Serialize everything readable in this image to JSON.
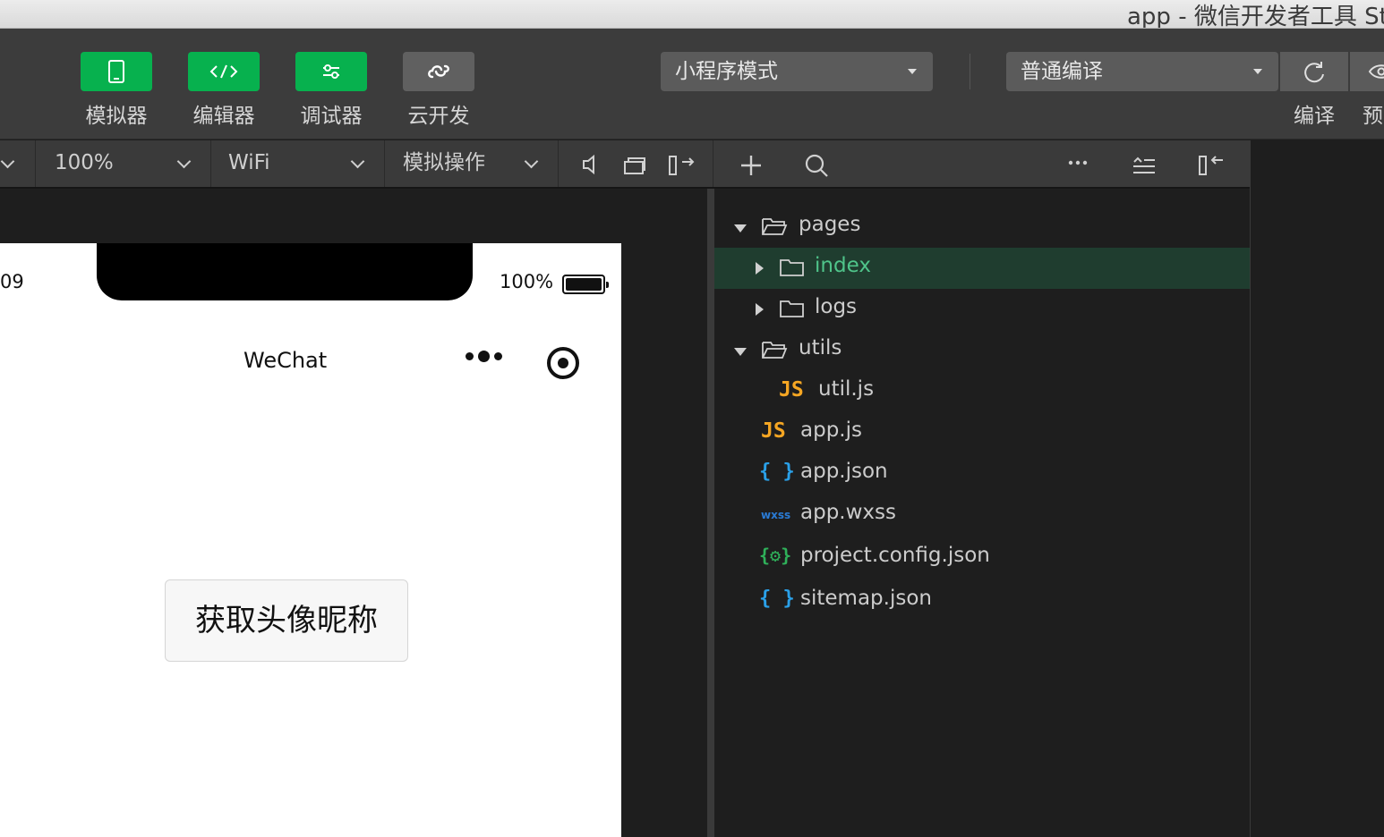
{
  "window": {
    "title": "app - 微信开发者工具 St"
  },
  "toolbar": {
    "buttons": [
      {
        "label": "模拟器",
        "icon": "phone-icon"
      },
      {
        "label": "编辑器",
        "icon": "code-icon"
      },
      {
        "label": "调试器",
        "icon": "sliders-icon"
      },
      {
        "label": "云开发",
        "icon": "cloud-icon"
      }
    ],
    "mode_select": "小程序模式",
    "compile_select": "普通编译",
    "compile_label": "编译",
    "preview_label": "预"
  },
  "subbar": {
    "zoom": "100%",
    "network": "WiFi",
    "simulate_ops": "模拟操作"
  },
  "simulator": {
    "status_time": "09",
    "battery_percent": "100%",
    "nav_title": "WeChat",
    "avatar_button": "获取头像昵称"
  },
  "explorer": {
    "items": [
      {
        "label": "pages",
        "type": "folder",
        "expanded": true
      },
      {
        "label": "index",
        "type": "folder",
        "expanded": false,
        "selected": true
      },
      {
        "label": "logs",
        "type": "folder",
        "expanded": false
      },
      {
        "label": "utils",
        "type": "folder",
        "expanded": true
      },
      {
        "label": "util.js",
        "type": "js",
        "icon_text": "JS"
      },
      {
        "label": "app.js",
        "type": "js",
        "icon_text": "JS"
      },
      {
        "label": "app.json",
        "type": "json",
        "icon_text": "{ }"
      },
      {
        "label": "app.wxss",
        "type": "wxss",
        "icon_text": "wxss"
      },
      {
        "label": "project.config.json",
        "type": "config",
        "icon_text": "{⚙}"
      },
      {
        "label": "sitemap.json",
        "type": "json",
        "icon_text": "{ }"
      }
    ]
  },
  "colors": {
    "accent_green": "#07b14e",
    "selected_row": "#1f3d2f",
    "selected_text": "#4fc48a",
    "js_icon": "#f5a623",
    "json_icon": "#2aa0e8"
  }
}
